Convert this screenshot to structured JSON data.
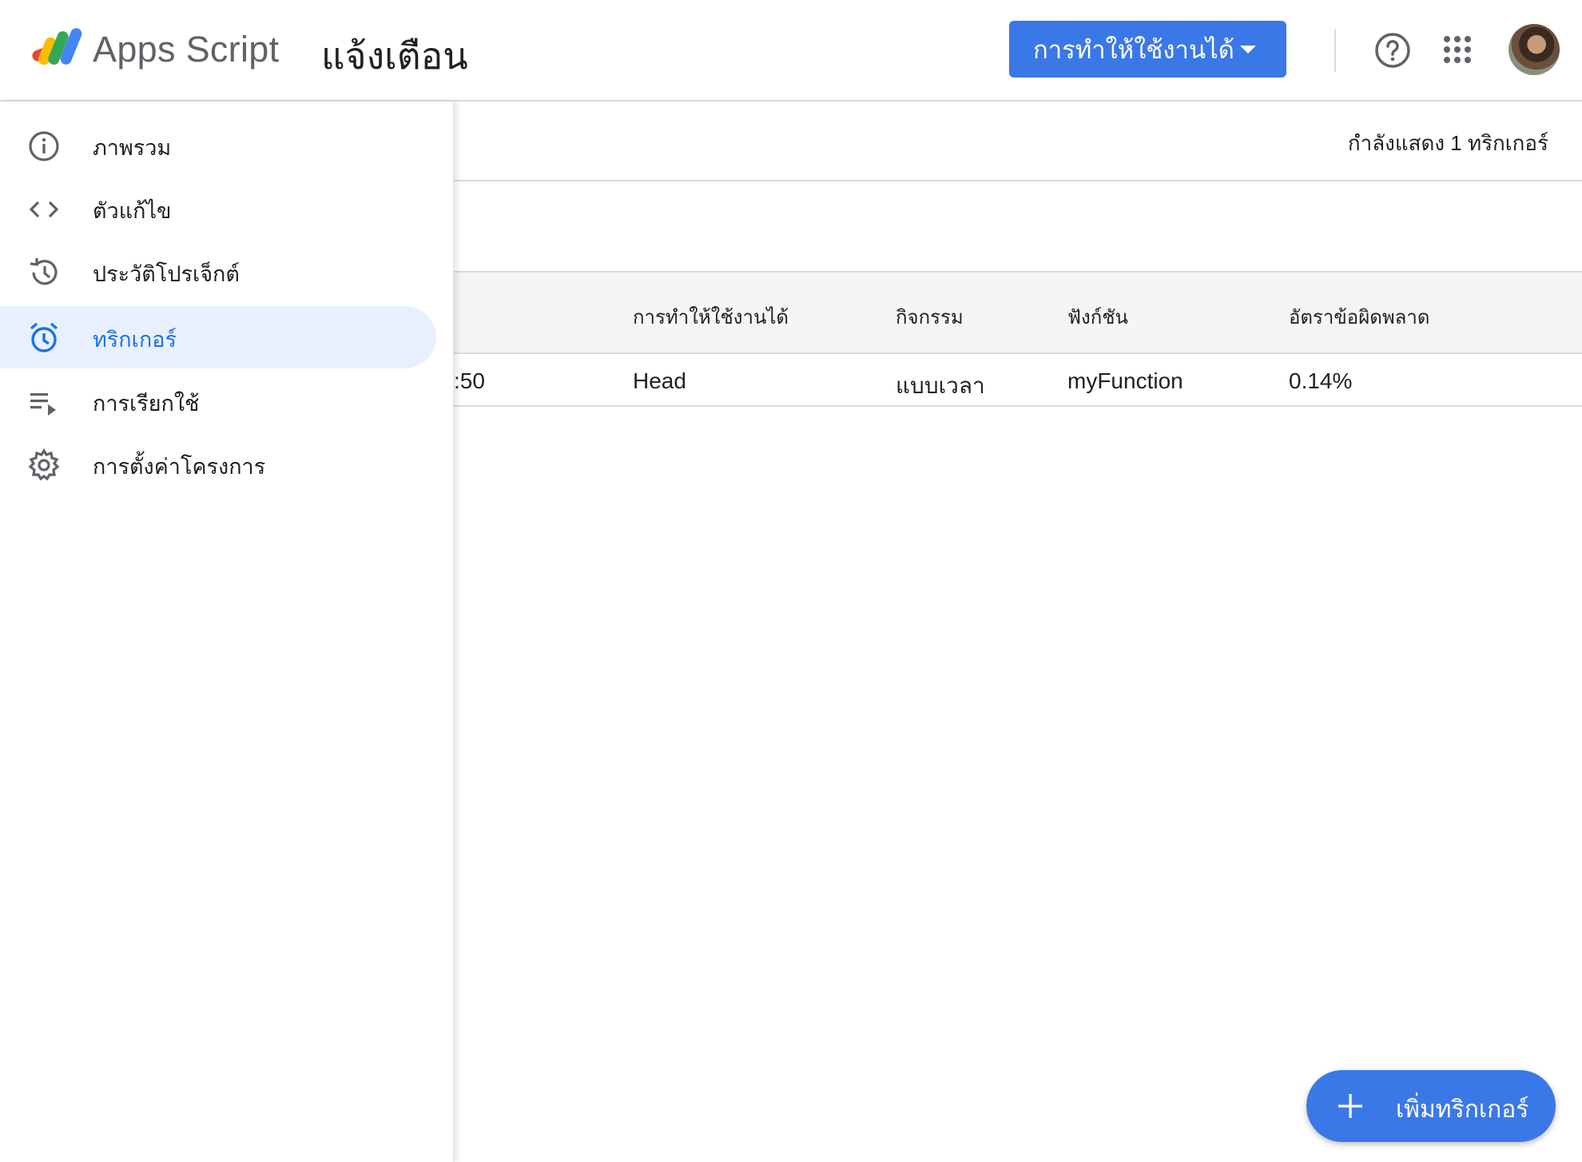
{
  "header": {
    "app_name": "Apps Script",
    "project_title": "แจ้งเตือน",
    "deploy_button": "การทำให้ใช้งานได้",
    "icons": [
      "apps-script-logo",
      "help-icon",
      "apps-grid-icon",
      "avatar"
    ]
  },
  "sidebar": {
    "items": [
      {
        "label": "ภาพรวม",
        "icon": "info-icon"
      },
      {
        "label": "ตัวแก้ไข",
        "icon": "code-icon"
      },
      {
        "label": "ประวัติโปรเจ็กต์",
        "icon": "history-icon"
      },
      {
        "label": "ทริกเกอร์",
        "icon": "alarm-icon",
        "active": true
      },
      {
        "label": "การเรียกใช้",
        "icon": "executions-icon"
      },
      {
        "label": "การตั้งค่าโครงการ",
        "icon": "gear-icon"
      }
    ]
  },
  "main": {
    "count_text": "กำลังแสดง 1 ทริกเกอร์",
    "table": {
      "headers": [
        "การทำให้ใช้งานได้",
        "กิจกรรม",
        "ฟังก์ชัน",
        "อัตราข้อผิดพลาด"
      ],
      "rows": [
        {
          "partial": ":50",
          "deployment": "Head",
          "event": "แบบเวลา",
          "function": "myFunction",
          "error_rate": "0.14%"
        }
      ]
    },
    "add_button": "เพิ่มทริกเกอร์"
  },
  "colors": {
    "accent": "#3b78e7",
    "active_bg": "#e8f0fe",
    "active_text": "#1a73e8"
  }
}
